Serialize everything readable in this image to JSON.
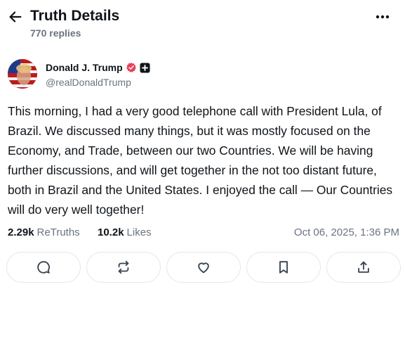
{
  "header": {
    "title": "Truth Details",
    "replies": "770 replies"
  },
  "author": {
    "name": "Donald J. Trump",
    "handle": "@realDonaldTrump"
  },
  "post": {
    "text": "This morning, I had a very good telephone call with President Lula, of Brazil. We discussed many things, but it was mostly focused on the Economy, and Trade, between our two Countries. We will be having further discussions, and will get together in the not too distant future, both in Brazil and the United States. I enjoyed the call — Our Countries will do very well together!"
  },
  "stats": {
    "retruths_count": "2.29k",
    "retruths_label": "ReTruths",
    "likes_count": "10.2k",
    "likes_label": "Likes",
    "timestamp": "Oct 06, 2025, 1:36 PM"
  },
  "actions": [
    "reply-icon",
    "retruth-icon",
    "heart-icon",
    "bookmark-icon",
    "share-icon"
  ],
  "colors": {
    "verified": "#e8435a",
    "text": "#0f1419",
    "muted": "#6b7280",
    "border": "#e5e7eb"
  }
}
